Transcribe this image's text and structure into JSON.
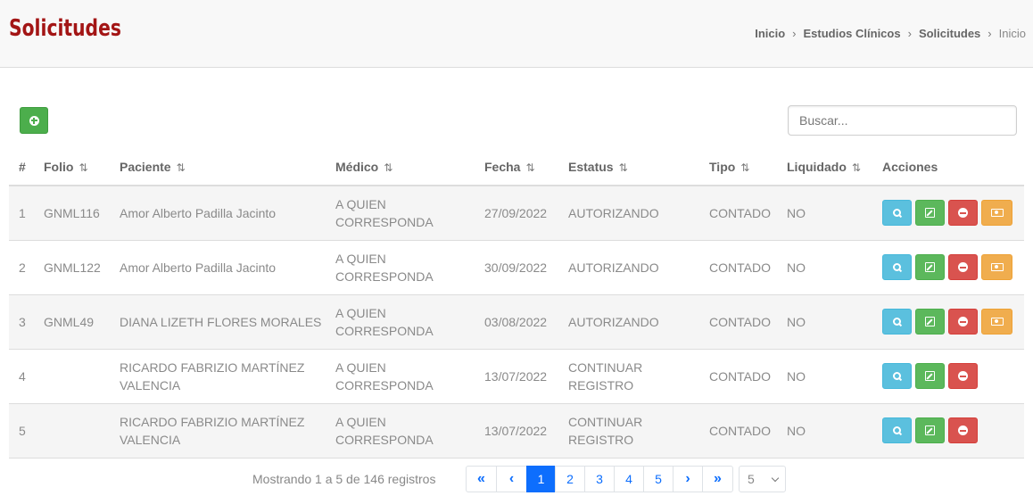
{
  "header": {
    "title": "Solicitudes",
    "breadcrumb": [
      "Inicio",
      "Estudios Clínicos",
      "Solicitudes",
      "Inicio"
    ],
    "breadcrumb_separator": "›"
  },
  "toolbar": {
    "add_icon": "plus-circle-icon"
  },
  "search": {
    "placeholder": "Buscar..."
  },
  "table": {
    "columns": [
      {
        "label": "#",
        "sortable": false
      },
      {
        "label": "Folio",
        "sortable": true
      },
      {
        "label": "Paciente",
        "sortable": true
      },
      {
        "label": "Médico",
        "sortable": true
      },
      {
        "label": "Fecha",
        "sortable": true
      },
      {
        "label": "Estatus",
        "sortable": true
      },
      {
        "label": "Tipo",
        "sortable": true
      },
      {
        "label": "Liquidado",
        "sortable": true
      },
      {
        "label": "Acciones",
        "sortable": false
      }
    ],
    "sort_icon": "⇅",
    "rows": [
      {
        "num": "1",
        "folio": "GNML116",
        "paciente": "Amor Alberto Padilla Jacinto",
        "medico": "A QUIEN CORRESPONDA",
        "fecha": "27/09/2022",
        "estatus": "AUTORIZANDO",
        "tipo": "CONTADO",
        "liquidado": "NO",
        "actions": [
          "view",
          "edit",
          "delete",
          "pay"
        ]
      },
      {
        "num": "2",
        "folio": "GNML122",
        "paciente": "Amor Alberto Padilla Jacinto",
        "medico": "A QUIEN CORRESPONDA",
        "fecha": "30/09/2022",
        "estatus": "AUTORIZANDO",
        "tipo": "CONTADO",
        "liquidado": "NO",
        "actions": [
          "view",
          "edit",
          "delete",
          "pay"
        ]
      },
      {
        "num": "3",
        "folio": "GNML49",
        "paciente": "DIANA LIZETH FLORES MORALES",
        "medico": "A QUIEN CORRESPONDA",
        "fecha": "03/08/2022",
        "estatus": "AUTORIZANDO",
        "tipo": "CONTADO",
        "liquidado": "NO",
        "actions": [
          "view",
          "edit",
          "delete",
          "pay"
        ]
      },
      {
        "num": "4",
        "folio": "",
        "paciente": "RICARDO FABRIZIO MARTÍNEZ VALENCIA",
        "medico": "A QUIEN CORRESPONDA",
        "fecha": "13/07/2022",
        "estatus": "CONTINUAR REGISTRO",
        "tipo": "CONTADO",
        "liquidado": "NO",
        "actions": [
          "view",
          "edit",
          "delete"
        ]
      },
      {
        "num": "5",
        "folio": "",
        "paciente": "RICARDO FABRIZIO MARTÍNEZ VALENCIA",
        "medico": "A QUIEN CORRESPONDA",
        "fecha": "13/07/2022",
        "estatus": "CONTINUAR REGISTRO",
        "tipo": "CONTADO",
        "liquidado": "NO",
        "actions": [
          "view",
          "edit",
          "delete"
        ]
      }
    ]
  },
  "pagination": {
    "info": "Mostrando 1 a 5 de 146 registros",
    "first": "«",
    "prev": "‹",
    "pages": [
      "1",
      "2",
      "3",
      "4",
      "5"
    ],
    "active_page": "1",
    "next": "›",
    "last": "»",
    "page_size": "5"
  },
  "colors": {
    "title": "#a31515",
    "add": "#4cae4c",
    "view": "#5bc0de",
    "edit": "#5cb85c",
    "delete": "#d9534f",
    "pay": "#f0ad4e",
    "page_active": "#0d6efd"
  }
}
